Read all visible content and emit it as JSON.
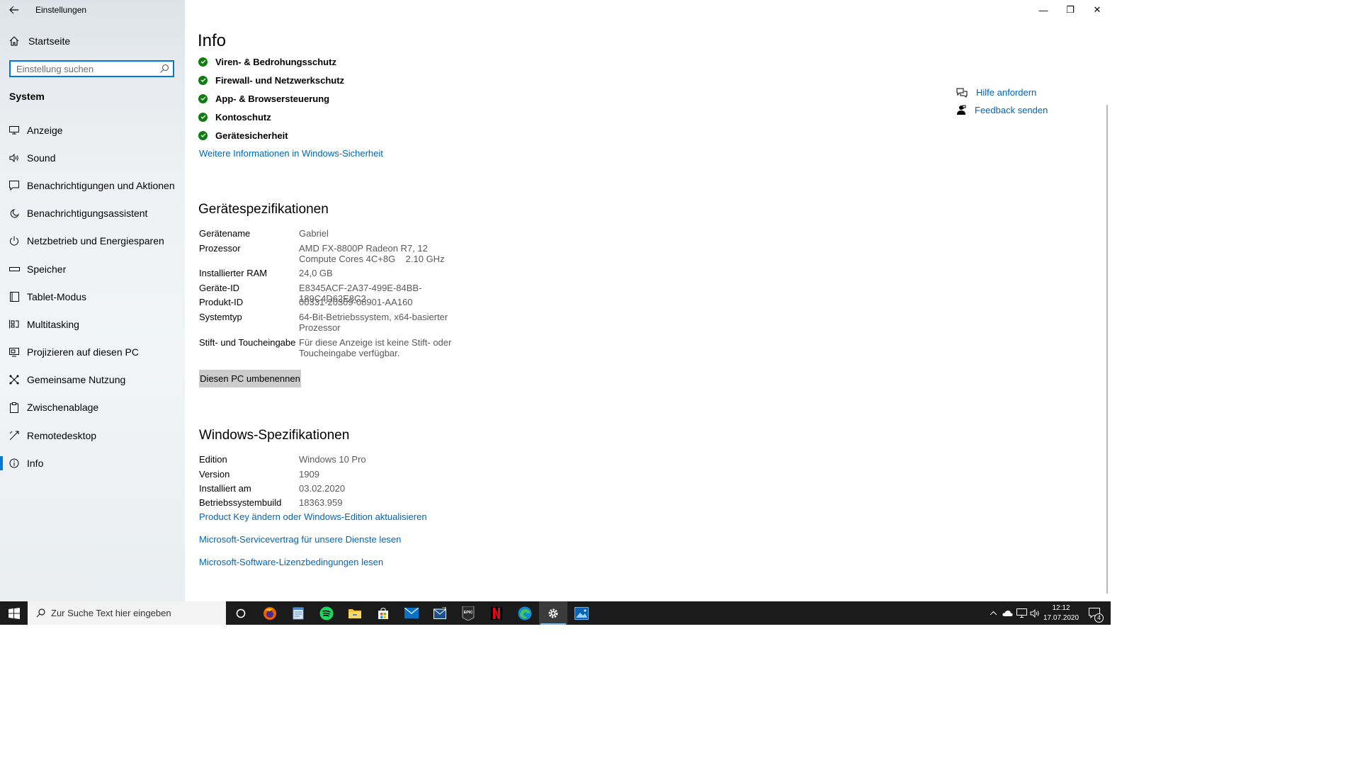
{
  "window": {
    "app_title": "Einstellungen",
    "minimize_glyph": "—",
    "maximize_glyph": "❐",
    "close_glyph": "✕"
  },
  "sidebar": {
    "home_label": "Startseite",
    "search_placeholder": "Einstellung suchen",
    "section_label": "System",
    "items": [
      {
        "label": "Anzeige",
        "icon": "display-icon"
      },
      {
        "label": "Sound",
        "icon": "speaker-icon"
      },
      {
        "label": "Benachrichtigungen und Aktionen",
        "icon": "notification-icon"
      },
      {
        "label": "Benachrichtigungsassistent",
        "icon": "moon-icon"
      },
      {
        "label": "Netzbetrieb und Energiesparen",
        "icon": "power-icon"
      },
      {
        "label": "Speicher",
        "icon": "storage-icon"
      },
      {
        "label": "Tablet-Modus",
        "icon": "tablet-icon"
      },
      {
        "label": "Multitasking",
        "icon": "multitasking-icon"
      },
      {
        "label": "Projizieren auf diesen PC",
        "icon": "project-icon"
      },
      {
        "label": "Gemeinsame Nutzung",
        "icon": "share-icon"
      },
      {
        "label": "Zwischenablage",
        "icon": "clipboard-icon"
      },
      {
        "label": "Remotedesktop",
        "icon": "remote-icon"
      },
      {
        "label": "Info",
        "icon": "info-icon",
        "active": true
      }
    ]
  },
  "main": {
    "title": "Info",
    "security_items": [
      "Viren- & Bedrohungsschutz",
      "Firewall- und Netzwerkschutz",
      "App- & Browsersteuerung",
      "Kontoschutz",
      "Gerätesicherheit"
    ],
    "security_link": "Weitere Informationen in Windows-Sicherheit",
    "device_specs": {
      "heading": "Gerätespezifikationen",
      "rows": [
        {
          "key": "Gerätename",
          "value": "Gabriel"
        },
        {
          "key": "Prozessor",
          "value": "AMD FX-8800P Radeon R7, 12 Compute Cores 4C+8G    2.10 GHz"
        },
        {
          "key": "Installierter RAM",
          "value": "24,0 GB"
        },
        {
          "key": "Geräte-ID",
          "value": "E8345ACF-2A37-499E-84BB-189C4D62E8C2"
        },
        {
          "key": "Produkt-ID",
          "value": "00331-20309-08901-AA160"
        },
        {
          "key": "Systemtyp",
          "value": "64-Bit-Betriebssystem, x64-basierter Prozessor"
        },
        {
          "key": "Stift- und Toucheingabe",
          "value": "Für diese Anzeige ist keine Stift- oder Toucheingabe verfügbar."
        }
      ],
      "rename_button": "Diesen PC umbenennen"
    },
    "windows_specs": {
      "heading": "Windows-Spezifikationen",
      "rows": [
        {
          "key": "Edition",
          "value": "Windows 10 Pro"
        },
        {
          "key": "Version",
          "value": "1909"
        },
        {
          "key": "Installiert am",
          "value": "03.02.2020"
        },
        {
          "key": "Betriebssystembuild",
          "value": "18363.959"
        }
      ],
      "links": [
        "Product Key ändern oder Windows-Edition aktualisieren",
        "Microsoft-Servicevertrag für unsere Dienste lesen",
        "Microsoft-Software-Lizenzbedingungen lesen"
      ]
    },
    "right_links": [
      {
        "label": "Hilfe anfordern",
        "icon": "help-icon"
      },
      {
        "label": "Feedback senden",
        "icon": "feedback-icon"
      }
    ]
  },
  "taskbar": {
    "search_placeholder": "Zur Suche Text hier eingeben",
    "apps": [
      "cortana-icon",
      "firefox-icon",
      "notepad-icon",
      "spotify-icon",
      "file-explorer-icon",
      "store-icon",
      "mail-icon",
      "mail2-icon",
      "epic-games-icon",
      "netflix-icon",
      "edge-icon",
      "settings-icon",
      "photos-icon"
    ],
    "epic_label": "EPIC",
    "time": "12:12",
    "date": "17.07.2020",
    "notification_count": "4",
    "colors": {
      "accent": "#0078d7",
      "link": "#0066b4",
      "check": "#107c10"
    }
  }
}
